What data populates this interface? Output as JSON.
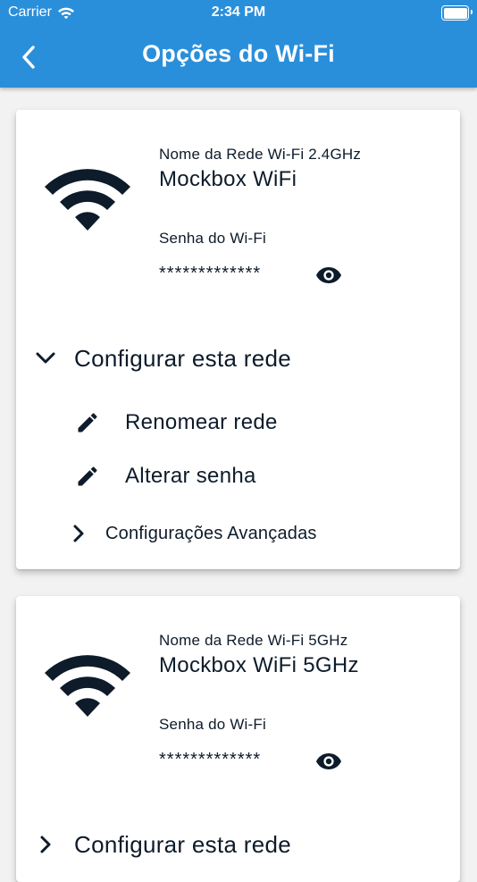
{
  "status_bar": {
    "carrier": "Carrier",
    "time": "2:34 PM"
  },
  "header": {
    "title": "Opções do Wi-Fi",
    "back_icon": "chevron-left-icon"
  },
  "colors": {
    "header_bg": "#2a8fdb",
    "page_bg": "#f2f2f2",
    "text_dark": "#0d1b2a"
  },
  "networks": [
    {
      "name_label": "Nome da Rede Wi-Fi 2.4GHz",
      "name": "Mockbox WiFi",
      "password_label": "Senha do Wi-Fi",
      "password_masked": "*************",
      "configure_label": "Configurar esta rede",
      "expanded": true,
      "actions": [
        {
          "label": "Renomear rede",
          "icon": "pencil-icon"
        },
        {
          "label": "Alterar senha",
          "icon": "pencil-icon"
        }
      ],
      "advanced_label": "Configurações Avançadas"
    },
    {
      "name_label": "Nome da Rede Wi-Fi 5GHz",
      "name": "Mockbox WiFi 5GHz",
      "password_label": "Senha do Wi-Fi",
      "password_masked": "*************",
      "configure_label": "Configurar esta rede",
      "expanded": false
    }
  ]
}
